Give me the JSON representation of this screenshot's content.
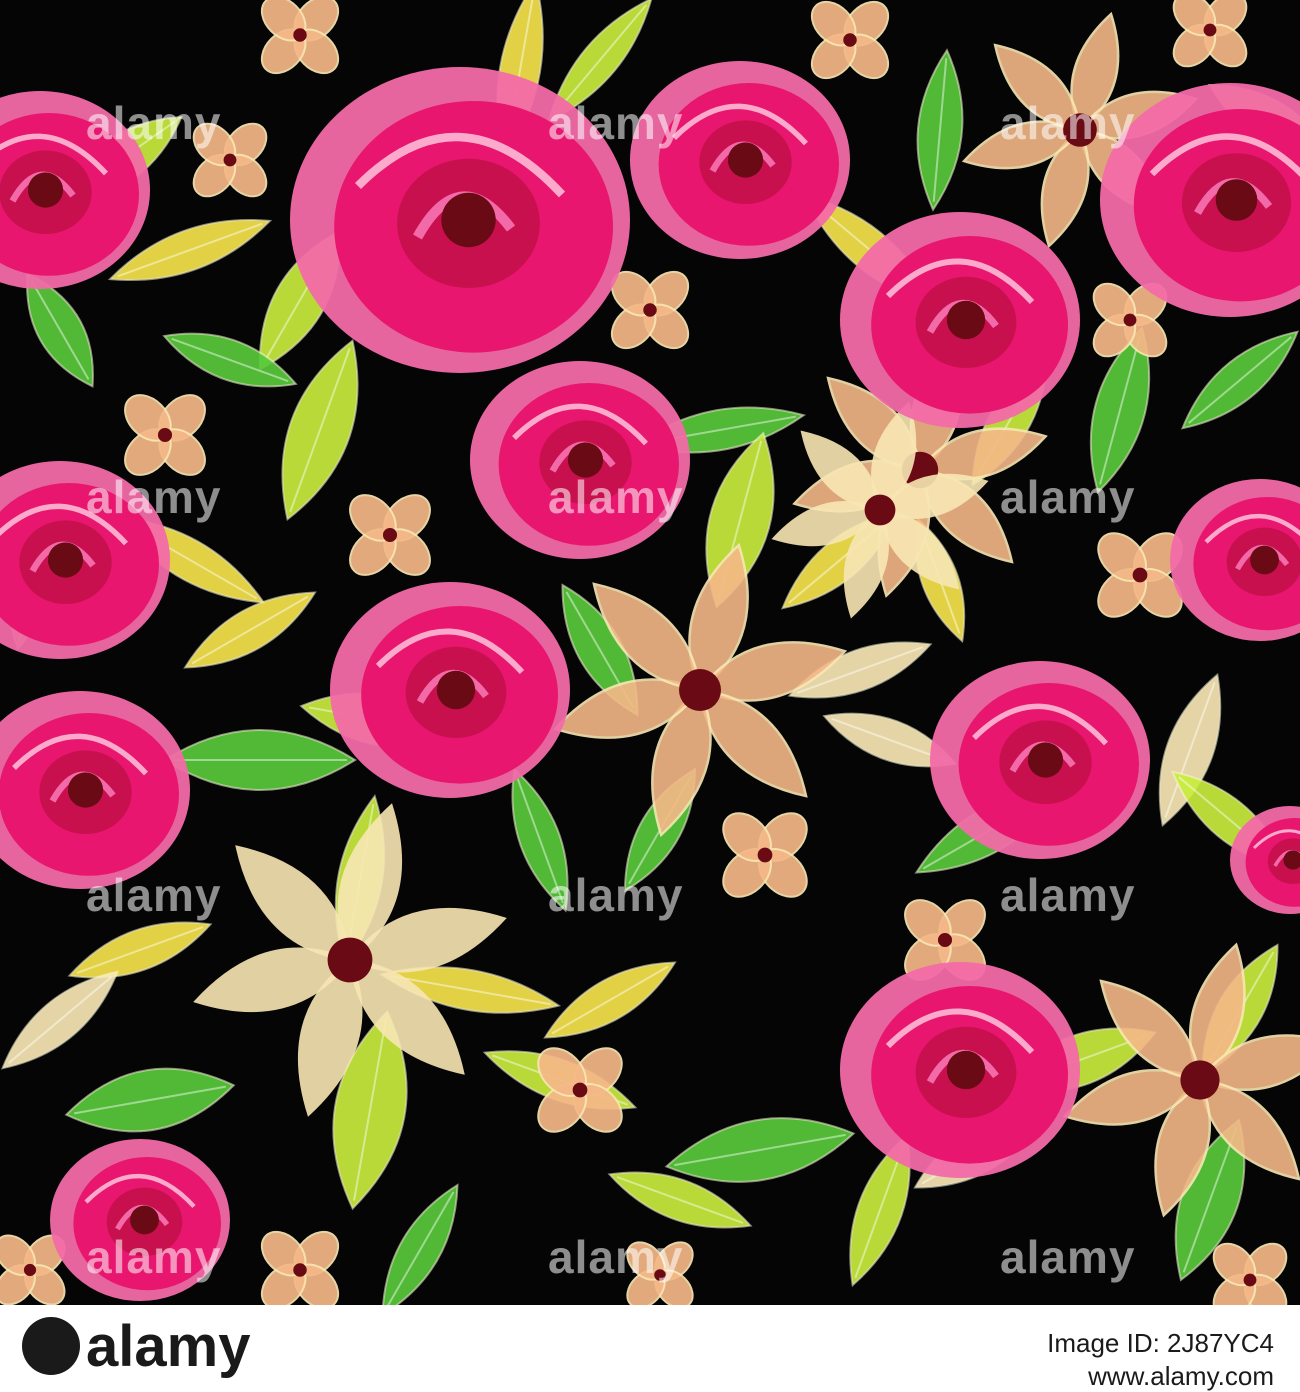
{
  "image": {
    "description": "Seamless watercolor floral pattern with magenta roses, peach lily-like flowers and lime-green leaves on a black background",
    "background_color": "#050505",
    "palette": {
      "rose": "#e8166e",
      "rose_deep": "#c9104f",
      "rose_light": "#f26aa8",
      "peach": "#f5b887",
      "cream": "#f8e7b4",
      "yellow": "#f5e34a",
      "lime": "#c8ec3c",
      "green": "#58c93a",
      "center": "#6a0a14"
    }
  },
  "watermark": {
    "brand": "alamy"
  },
  "footer": {
    "logo_text": "alamy",
    "image_id_label": "Image ID: 2J87YC4",
    "site": "www.alamy.com"
  }
}
